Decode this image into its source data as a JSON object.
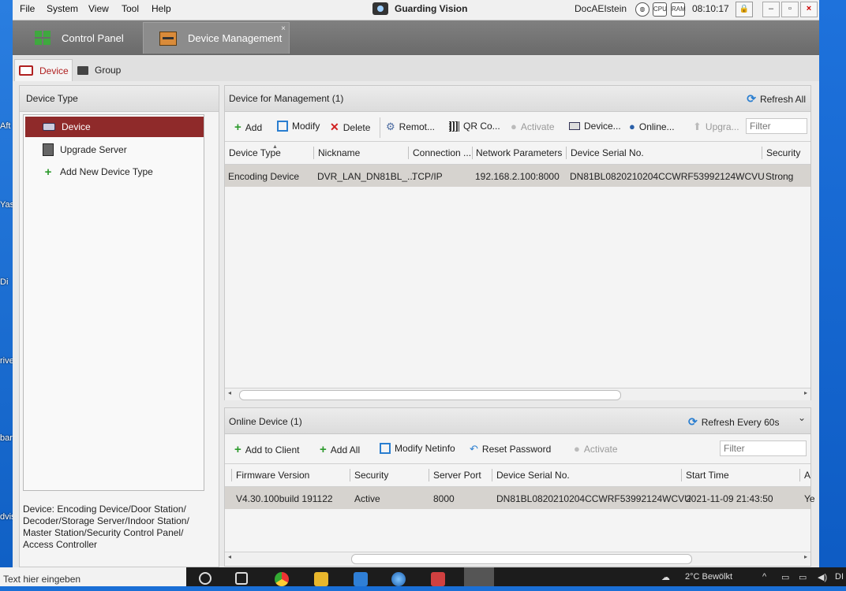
{
  "desktop": {
    "fragments": [
      "Aft",
      "Yas",
      "Di",
      "rive",
      "bar",
      "dvis"
    ]
  },
  "menubar": {
    "items": [
      "File",
      "System",
      "View",
      "Tool",
      "Help"
    ],
    "brand": "Guarding Vision",
    "user": "DocAEIstein",
    "clock": "08:10:17",
    "cpu_label": "CPU",
    "ram_label": "RAM"
  },
  "main_tabs": [
    {
      "label": "Control Panel"
    },
    {
      "label": "Device Management"
    }
  ],
  "sub_tabs": [
    {
      "label": "Device"
    },
    {
      "label": "Group"
    }
  ],
  "left_panel": {
    "title": "Device Type",
    "items": [
      {
        "label": "Device"
      },
      {
        "label": "Upgrade Server"
      },
      {
        "label": "Add New Device Type"
      }
    ],
    "description": "Device: Encoding Device/Door Station/ Decoder/Storage Server/Indoor Station/ Master Station/Security Control Panel/ Access Controller"
  },
  "management": {
    "title": "Device for Management (1)",
    "refresh_label": "Refresh All",
    "toolbar": {
      "add": "Add",
      "modify": "Modify",
      "delete": "Delete",
      "remote": "Remot...",
      "qr": "QR Co...",
      "activate": "Activate",
      "device": "Device...",
      "online": "Online...",
      "upgrade": "Upgra...",
      "filter_placeholder": "Filter"
    },
    "columns": [
      "Device Type",
      "Nickname",
      "Connection ...",
      "Network Parameters",
      "Device Serial No.",
      "Security"
    ],
    "rows": [
      [
        "Encoding Device",
        "DVR_LAN_DN81BL_...",
        "TCP/IP",
        "192.168.2.100:8000",
        "DN81BL0820210204CCWRF53992124WCVU",
        "Strong"
      ]
    ]
  },
  "online": {
    "title": "Online Device (1)",
    "refresh_label": "Refresh Every 60s",
    "toolbar": {
      "add_to_client": "Add to Client",
      "add_all": "Add All",
      "modify_netinfo": "Modify Netinfo",
      "reset_password": "Reset Password",
      "activate": "Activate",
      "filter_placeholder": "Filter"
    },
    "columns": [
      "Firmware Version",
      "Security",
      "Server Port",
      "Device Serial No.",
      "Start Time",
      "A"
    ],
    "rows": [
      [
        "V4.30.100build 191122",
        "Active",
        "8000",
        "DN81BL0820210204CCWRF53992124WCVU",
        "2021-11-09 21:43:50",
        "Ye"
      ]
    ]
  },
  "taskbar": {
    "search_placeholder": "Text hier eingeben",
    "weather": "2°C  Bewölkt",
    "tray_fragment": "DI"
  }
}
